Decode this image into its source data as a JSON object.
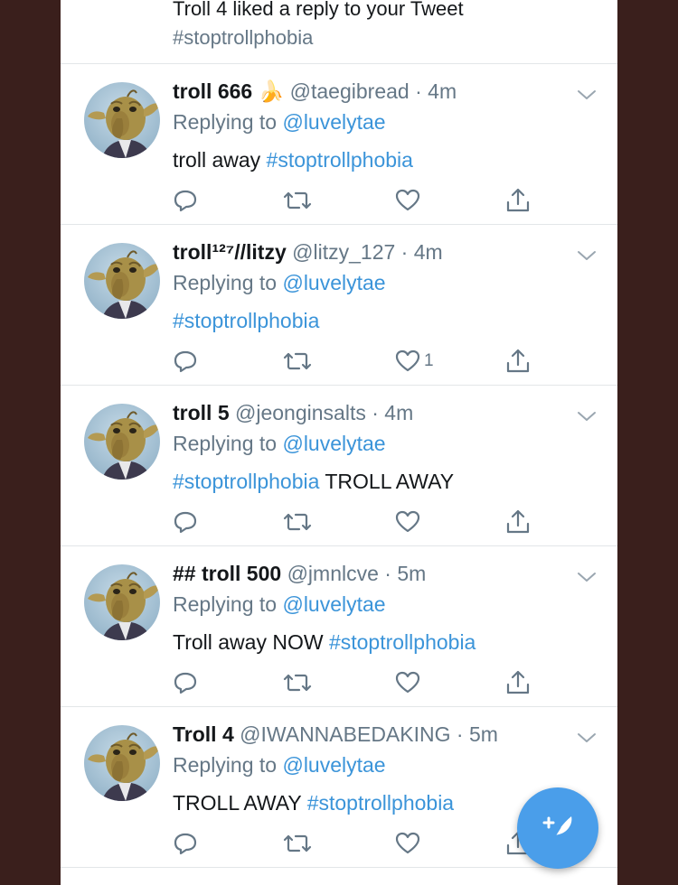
{
  "notification": {
    "text": "Troll 4 liked a reply to your Tweet",
    "hashtag": "#stoptrollphobia"
  },
  "tweets": [
    {
      "name": "troll 666",
      "emoji": "🍌",
      "handle": "@taegibread",
      "time": "4m",
      "replying_prefix": "Replying to",
      "replying_to": "@luvelytae",
      "text_before": "troll away ",
      "hashtag": "#stoptrollphobia",
      "text_after": "",
      "like_count": ""
    },
    {
      "name": "troll¹²⁷//litzy",
      "emoji": "",
      "handle": "@litzy_127",
      "time": "4m",
      "replying_prefix": "Replying to",
      "replying_to": "@luvelytae",
      "text_before": "",
      "hashtag": "#stoptrollphobia",
      "text_after": "",
      "like_count": "1"
    },
    {
      "name": "troll 5",
      "emoji": "",
      "handle": "@jeonginsalts",
      "time": "4m",
      "replying_prefix": "Replying to",
      "replying_to": "@luvelytae",
      "text_before": "",
      "hashtag": "#stoptrollphobia",
      "text_after": " TROLL AWAY",
      "like_count": ""
    },
    {
      "name": "## troll 500",
      "emoji": "",
      "handle": "@jmnlcve",
      "time": "5m",
      "replying_prefix": "Replying to",
      "replying_to": "@luvelytae",
      "text_before": "Troll away NOW ",
      "hashtag": "#stoptrollphobia",
      "text_after": "",
      "like_count": ""
    },
    {
      "name": "Troll 4",
      "emoji": "",
      "handle": "@IWANNABEDAKING",
      "time": "5m",
      "replying_prefix": "Replying to",
      "replying_to": "@luvelytae",
      "text_before": "TROLL AWAY ",
      "hashtag": "#stoptrollphobia",
      "text_after": "",
      "like_count": ""
    }
  ],
  "colors": {
    "link": "#3b94d9",
    "secondary_text": "#657786",
    "fab": "#4a9eea",
    "outer_background": "#3a1f1c"
  },
  "icons": [
    "reply-icon",
    "retweet-icon",
    "like-icon",
    "share-icon",
    "chevron-down-icon",
    "compose-tweet-icon"
  ]
}
